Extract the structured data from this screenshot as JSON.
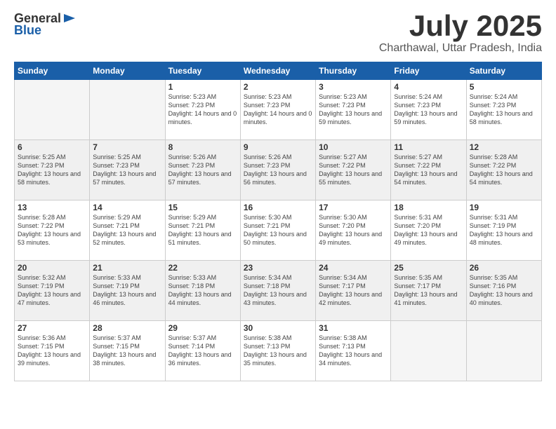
{
  "header": {
    "logo_general": "General",
    "logo_blue": "Blue",
    "month": "July 2025",
    "location": "Charthawal, Uttar Pradesh, India"
  },
  "weekdays": [
    "Sunday",
    "Monday",
    "Tuesday",
    "Wednesday",
    "Thursday",
    "Friday",
    "Saturday"
  ],
  "weeks": [
    [
      {
        "day": "",
        "empty": true
      },
      {
        "day": "",
        "empty": true
      },
      {
        "day": "1",
        "sunrise": "Sunrise: 5:23 AM",
        "sunset": "Sunset: 7:23 PM",
        "daylight": "Daylight: 14 hours and 0 minutes."
      },
      {
        "day": "2",
        "sunrise": "Sunrise: 5:23 AM",
        "sunset": "Sunset: 7:23 PM",
        "daylight": "Daylight: 14 hours and 0 minutes."
      },
      {
        "day": "3",
        "sunrise": "Sunrise: 5:23 AM",
        "sunset": "Sunset: 7:23 PM",
        "daylight": "Daylight: 13 hours and 59 minutes."
      },
      {
        "day": "4",
        "sunrise": "Sunrise: 5:24 AM",
        "sunset": "Sunset: 7:23 PM",
        "daylight": "Daylight: 13 hours and 59 minutes."
      },
      {
        "day": "5",
        "sunrise": "Sunrise: 5:24 AM",
        "sunset": "Sunset: 7:23 PM",
        "daylight": "Daylight: 13 hours and 58 minutes."
      }
    ],
    [
      {
        "day": "6",
        "sunrise": "Sunrise: 5:25 AM",
        "sunset": "Sunset: 7:23 PM",
        "daylight": "Daylight: 13 hours and 58 minutes."
      },
      {
        "day": "7",
        "sunrise": "Sunrise: 5:25 AM",
        "sunset": "Sunset: 7:23 PM",
        "daylight": "Daylight: 13 hours and 57 minutes."
      },
      {
        "day": "8",
        "sunrise": "Sunrise: 5:26 AM",
        "sunset": "Sunset: 7:23 PM",
        "daylight": "Daylight: 13 hours and 57 minutes."
      },
      {
        "day": "9",
        "sunrise": "Sunrise: 5:26 AM",
        "sunset": "Sunset: 7:23 PM",
        "daylight": "Daylight: 13 hours and 56 minutes."
      },
      {
        "day": "10",
        "sunrise": "Sunrise: 5:27 AM",
        "sunset": "Sunset: 7:22 PM",
        "daylight": "Daylight: 13 hours and 55 minutes."
      },
      {
        "day": "11",
        "sunrise": "Sunrise: 5:27 AM",
        "sunset": "Sunset: 7:22 PM",
        "daylight": "Daylight: 13 hours and 54 minutes."
      },
      {
        "day": "12",
        "sunrise": "Sunrise: 5:28 AM",
        "sunset": "Sunset: 7:22 PM",
        "daylight": "Daylight: 13 hours and 54 minutes."
      }
    ],
    [
      {
        "day": "13",
        "sunrise": "Sunrise: 5:28 AM",
        "sunset": "Sunset: 7:22 PM",
        "daylight": "Daylight: 13 hours and 53 minutes."
      },
      {
        "day": "14",
        "sunrise": "Sunrise: 5:29 AM",
        "sunset": "Sunset: 7:21 PM",
        "daylight": "Daylight: 13 hours and 52 minutes."
      },
      {
        "day": "15",
        "sunrise": "Sunrise: 5:29 AM",
        "sunset": "Sunset: 7:21 PM",
        "daylight": "Daylight: 13 hours and 51 minutes."
      },
      {
        "day": "16",
        "sunrise": "Sunrise: 5:30 AM",
        "sunset": "Sunset: 7:21 PM",
        "daylight": "Daylight: 13 hours and 50 minutes."
      },
      {
        "day": "17",
        "sunrise": "Sunrise: 5:30 AM",
        "sunset": "Sunset: 7:20 PM",
        "daylight": "Daylight: 13 hours and 49 minutes."
      },
      {
        "day": "18",
        "sunrise": "Sunrise: 5:31 AM",
        "sunset": "Sunset: 7:20 PM",
        "daylight": "Daylight: 13 hours and 49 minutes."
      },
      {
        "day": "19",
        "sunrise": "Sunrise: 5:31 AM",
        "sunset": "Sunset: 7:19 PM",
        "daylight": "Daylight: 13 hours and 48 minutes."
      }
    ],
    [
      {
        "day": "20",
        "sunrise": "Sunrise: 5:32 AM",
        "sunset": "Sunset: 7:19 PM",
        "daylight": "Daylight: 13 hours and 47 minutes."
      },
      {
        "day": "21",
        "sunrise": "Sunrise: 5:33 AM",
        "sunset": "Sunset: 7:19 PM",
        "daylight": "Daylight: 13 hours and 46 minutes."
      },
      {
        "day": "22",
        "sunrise": "Sunrise: 5:33 AM",
        "sunset": "Sunset: 7:18 PM",
        "daylight": "Daylight: 13 hours and 44 minutes."
      },
      {
        "day": "23",
        "sunrise": "Sunrise: 5:34 AM",
        "sunset": "Sunset: 7:18 PM",
        "daylight": "Daylight: 13 hours and 43 minutes."
      },
      {
        "day": "24",
        "sunrise": "Sunrise: 5:34 AM",
        "sunset": "Sunset: 7:17 PM",
        "daylight": "Daylight: 13 hours and 42 minutes."
      },
      {
        "day": "25",
        "sunrise": "Sunrise: 5:35 AM",
        "sunset": "Sunset: 7:17 PM",
        "daylight": "Daylight: 13 hours and 41 minutes."
      },
      {
        "day": "26",
        "sunrise": "Sunrise: 5:35 AM",
        "sunset": "Sunset: 7:16 PM",
        "daylight": "Daylight: 13 hours and 40 minutes."
      }
    ],
    [
      {
        "day": "27",
        "sunrise": "Sunrise: 5:36 AM",
        "sunset": "Sunset: 7:15 PM",
        "daylight": "Daylight: 13 hours and 39 minutes."
      },
      {
        "day": "28",
        "sunrise": "Sunrise: 5:37 AM",
        "sunset": "Sunset: 7:15 PM",
        "daylight": "Daylight: 13 hours and 38 minutes."
      },
      {
        "day": "29",
        "sunrise": "Sunrise: 5:37 AM",
        "sunset": "Sunset: 7:14 PM",
        "daylight": "Daylight: 13 hours and 36 minutes."
      },
      {
        "day": "30",
        "sunrise": "Sunrise: 5:38 AM",
        "sunset": "Sunset: 7:13 PM",
        "daylight": "Daylight: 13 hours and 35 minutes."
      },
      {
        "day": "31",
        "sunrise": "Sunrise: 5:38 AM",
        "sunset": "Sunset: 7:13 PM",
        "daylight": "Daylight: 13 hours and 34 minutes."
      },
      {
        "day": "",
        "empty": true
      },
      {
        "day": "",
        "empty": true
      }
    ]
  ]
}
